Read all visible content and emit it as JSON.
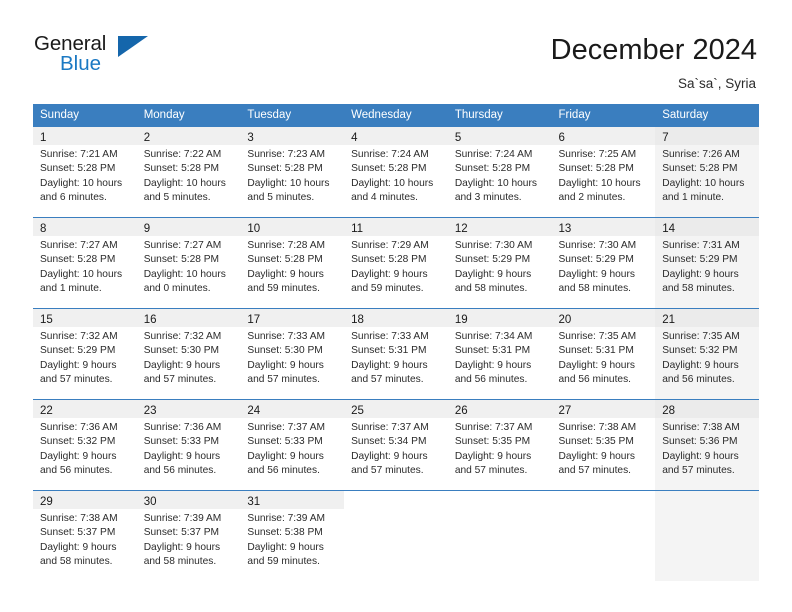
{
  "brand": {
    "name_part1": "General",
    "name_part2": "Blue",
    "accent_color": "#1b79c3",
    "triangle_color": "#1566ab"
  },
  "header": {
    "title": "December 2024",
    "location": "Sa`sa`, Syria",
    "header_bg_color": "#3a7ebf"
  },
  "calendar": {
    "weekday_headers": [
      "Sunday",
      "Monday",
      "Tuesday",
      "Wednesday",
      "Thursday",
      "Friday",
      "Saturday"
    ],
    "labels": {
      "sunrise_prefix": "Sunrise:",
      "sunset_prefix": "Sunset:",
      "daylight_prefix": "Daylight:"
    },
    "weeks": [
      [
        {
          "day": "1",
          "sunrise": "Sunrise: 7:21 AM",
          "sunset": "Sunset: 5:28 PM",
          "daylight_line1": "Daylight: 10 hours",
          "daylight_line2": "and 6 minutes."
        },
        {
          "day": "2",
          "sunrise": "Sunrise: 7:22 AM",
          "sunset": "Sunset: 5:28 PM",
          "daylight_line1": "Daylight: 10 hours",
          "daylight_line2": "and 5 minutes."
        },
        {
          "day": "3",
          "sunrise": "Sunrise: 7:23 AM",
          "sunset": "Sunset: 5:28 PM",
          "daylight_line1": "Daylight: 10 hours",
          "daylight_line2": "and 5 minutes."
        },
        {
          "day": "4",
          "sunrise": "Sunrise: 7:24 AM",
          "sunset": "Sunset: 5:28 PM",
          "daylight_line1": "Daylight: 10 hours",
          "daylight_line2": "and 4 minutes."
        },
        {
          "day": "5",
          "sunrise": "Sunrise: 7:24 AM",
          "sunset": "Sunset: 5:28 PM",
          "daylight_line1": "Daylight: 10 hours",
          "daylight_line2": "and 3 minutes."
        },
        {
          "day": "6",
          "sunrise": "Sunrise: 7:25 AM",
          "sunset": "Sunset: 5:28 PM",
          "daylight_line1": "Daylight: 10 hours",
          "daylight_line2": "and 2 minutes."
        },
        {
          "day": "7",
          "sunrise": "Sunrise: 7:26 AM",
          "sunset": "Sunset: 5:28 PM",
          "daylight_line1": "Daylight: 10 hours",
          "daylight_line2": "and 1 minute."
        }
      ],
      [
        {
          "day": "8",
          "sunrise": "Sunrise: 7:27 AM",
          "sunset": "Sunset: 5:28 PM",
          "daylight_line1": "Daylight: 10 hours",
          "daylight_line2": "and 1 minute."
        },
        {
          "day": "9",
          "sunrise": "Sunrise: 7:27 AM",
          "sunset": "Sunset: 5:28 PM",
          "daylight_line1": "Daylight: 10 hours",
          "daylight_line2": "and 0 minutes."
        },
        {
          "day": "10",
          "sunrise": "Sunrise: 7:28 AM",
          "sunset": "Sunset: 5:28 PM",
          "daylight_line1": "Daylight: 9 hours",
          "daylight_line2": "and 59 minutes."
        },
        {
          "day": "11",
          "sunrise": "Sunrise: 7:29 AM",
          "sunset": "Sunset: 5:28 PM",
          "daylight_line1": "Daylight: 9 hours",
          "daylight_line2": "and 59 minutes."
        },
        {
          "day": "12",
          "sunrise": "Sunrise: 7:30 AM",
          "sunset": "Sunset: 5:29 PM",
          "daylight_line1": "Daylight: 9 hours",
          "daylight_line2": "and 58 minutes."
        },
        {
          "day": "13",
          "sunrise": "Sunrise: 7:30 AM",
          "sunset": "Sunset: 5:29 PM",
          "daylight_line1": "Daylight: 9 hours",
          "daylight_line2": "and 58 minutes."
        },
        {
          "day": "14",
          "sunrise": "Sunrise: 7:31 AM",
          "sunset": "Sunset: 5:29 PM",
          "daylight_line1": "Daylight: 9 hours",
          "daylight_line2": "and 58 minutes."
        }
      ],
      [
        {
          "day": "15",
          "sunrise": "Sunrise: 7:32 AM",
          "sunset": "Sunset: 5:29 PM",
          "daylight_line1": "Daylight: 9 hours",
          "daylight_line2": "and 57 minutes."
        },
        {
          "day": "16",
          "sunrise": "Sunrise: 7:32 AM",
          "sunset": "Sunset: 5:30 PM",
          "daylight_line1": "Daylight: 9 hours",
          "daylight_line2": "and 57 minutes."
        },
        {
          "day": "17",
          "sunrise": "Sunrise: 7:33 AM",
          "sunset": "Sunset: 5:30 PM",
          "daylight_line1": "Daylight: 9 hours",
          "daylight_line2": "and 57 minutes."
        },
        {
          "day": "18",
          "sunrise": "Sunrise: 7:33 AM",
          "sunset": "Sunset: 5:31 PM",
          "daylight_line1": "Daylight: 9 hours",
          "daylight_line2": "and 57 minutes."
        },
        {
          "day": "19",
          "sunrise": "Sunrise: 7:34 AM",
          "sunset": "Sunset: 5:31 PM",
          "daylight_line1": "Daylight: 9 hours",
          "daylight_line2": "and 56 minutes."
        },
        {
          "day": "20",
          "sunrise": "Sunrise: 7:35 AM",
          "sunset": "Sunset: 5:31 PM",
          "daylight_line1": "Daylight: 9 hours",
          "daylight_line2": "and 56 minutes."
        },
        {
          "day": "21",
          "sunrise": "Sunrise: 7:35 AM",
          "sunset": "Sunset: 5:32 PM",
          "daylight_line1": "Daylight: 9 hours",
          "daylight_line2": "and 56 minutes."
        }
      ],
      [
        {
          "day": "22",
          "sunrise": "Sunrise: 7:36 AM",
          "sunset": "Sunset: 5:32 PM",
          "daylight_line1": "Daylight: 9 hours",
          "daylight_line2": "and 56 minutes."
        },
        {
          "day": "23",
          "sunrise": "Sunrise: 7:36 AM",
          "sunset": "Sunset: 5:33 PM",
          "daylight_line1": "Daylight: 9 hours",
          "daylight_line2": "and 56 minutes."
        },
        {
          "day": "24",
          "sunrise": "Sunrise: 7:37 AM",
          "sunset": "Sunset: 5:33 PM",
          "daylight_line1": "Daylight: 9 hours",
          "daylight_line2": "and 56 minutes."
        },
        {
          "day": "25",
          "sunrise": "Sunrise: 7:37 AM",
          "sunset": "Sunset: 5:34 PM",
          "daylight_line1": "Daylight: 9 hours",
          "daylight_line2": "and 57 minutes."
        },
        {
          "day": "26",
          "sunrise": "Sunrise: 7:37 AM",
          "sunset": "Sunset: 5:35 PM",
          "daylight_line1": "Daylight: 9 hours",
          "daylight_line2": "and 57 minutes."
        },
        {
          "day": "27",
          "sunrise": "Sunrise: 7:38 AM",
          "sunset": "Sunset: 5:35 PM",
          "daylight_line1": "Daylight: 9 hours",
          "daylight_line2": "and 57 minutes."
        },
        {
          "day": "28",
          "sunrise": "Sunrise: 7:38 AM",
          "sunset": "Sunset: 5:36 PM",
          "daylight_line1": "Daylight: 9 hours",
          "daylight_line2": "and 57 minutes."
        }
      ],
      [
        {
          "day": "29",
          "sunrise": "Sunrise: 7:38 AM",
          "sunset": "Sunset: 5:37 PM",
          "daylight_line1": "Daylight: 9 hours",
          "daylight_line2": "and 58 minutes."
        },
        {
          "day": "30",
          "sunrise": "Sunrise: 7:39 AM",
          "sunset": "Sunset: 5:37 PM",
          "daylight_line1": "Daylight: 9 hours",
          "daylight_line2": "and 58 minutes."
        },
        {
          "day": "31",
          "sunrise": "Sunrise: 7:39 AM",
          "sunset": "Sunset: 5:38 PM",
          "daylight_line1": "Daylight: 9 hours",
          "daylight_line2": "and 59 minutes."
        },
        null,
        null,
        null,
        null
      ]
    ]
  }
}
